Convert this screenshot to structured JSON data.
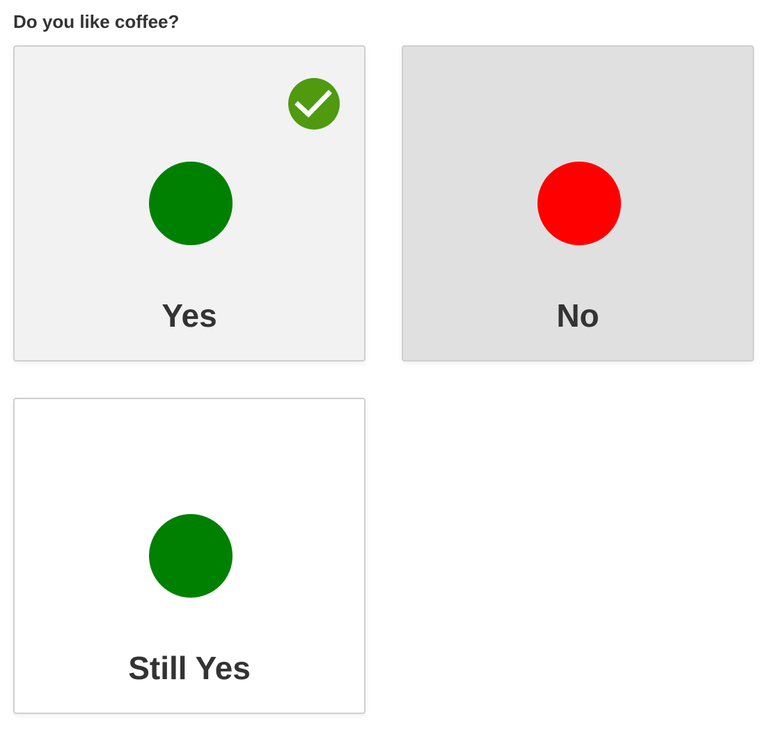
{
  "question": "Do you like coffee?",
  "options": [
    {
      "label": "Yes",
      "indicator_color": "#008000",
      "selected": true,
      "card_bg": "#f2f2f2"
    },
    {
      "label": "No",
      "indicator_color": "#ff0000",
      "selected": false,
      "card_bg": "#e0e0e0"
    },
    {
      "label": "Still Yes",
      "indicator_color": "#008000",
      "selected": false,
      "card_bg": "#ffffff"
    }
  ],
  "check_badge_color": "#4f9a0f",
  "check_icon": "checkmark-icon"
}
